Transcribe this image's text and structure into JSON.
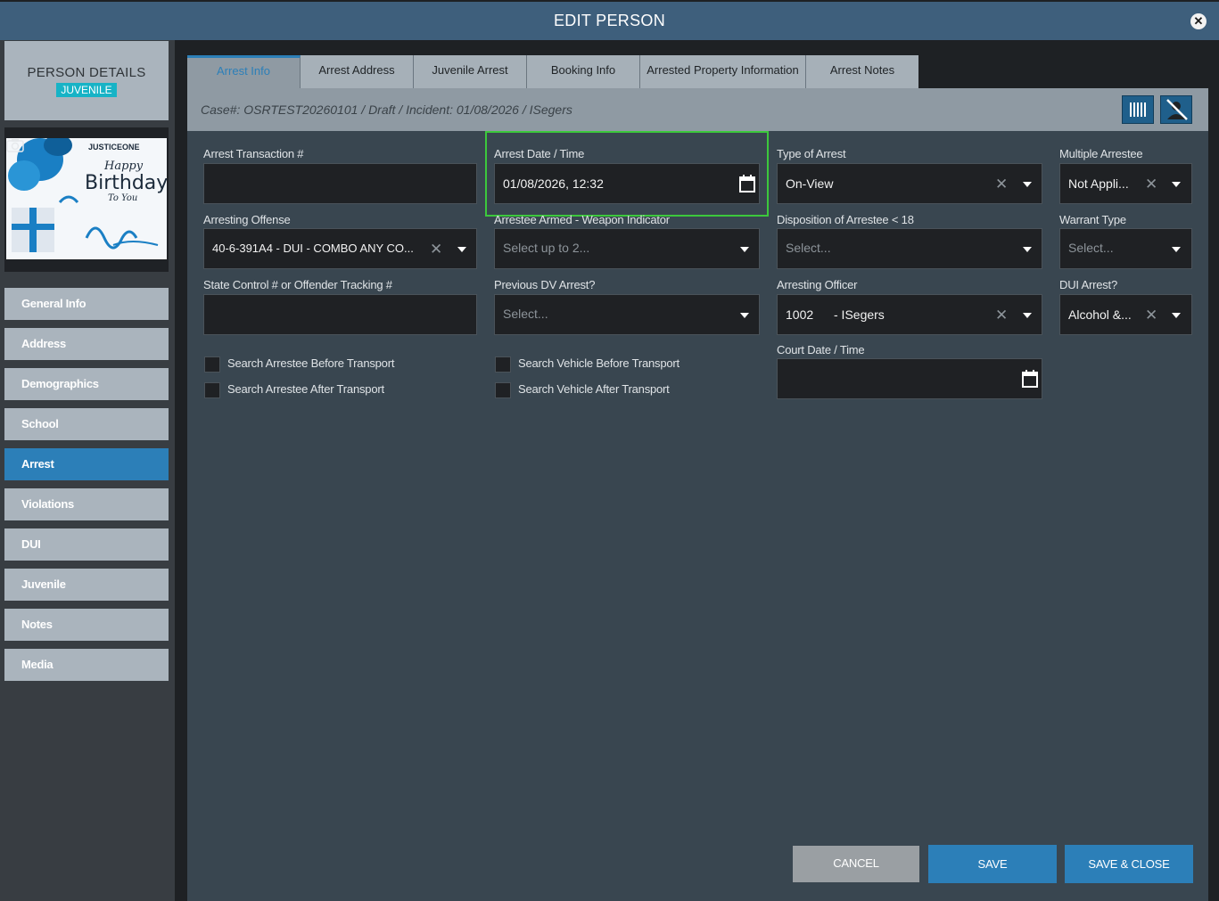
{
  "window": {
    "title": "EDIT PERSON"
  },
  "sidebar": {
    "header": {
      "title": "PERSON DETAILS",
      "badge": "JUVENILE"
    },
    "photo": {
      "line1": "JUSTICEONE",
      "line2": "Happy",
      "line3": "Birthday",
      "line4": "To You"
    },
    "items": [
      {
        "label": "General Info"
      },
      {
        "label": "Address"
      },
      {
        "label": "Demographics"
      },
      {
        "label": "School"
      },
      {
        "label": "Arrest",
        "active": true
      },
      {
        "label": "Violations"
      },
      {
        "label": "DUI"
      },
      {
        "label": "Juvenile"
      },
      {
        "label": "Notes"
      },
      {
        "label": "Media"
      }
    ]
  },
  "tabs": [
    {
      "label": "Arrest Info",
      "active": true
    },
    {
      "label": "Arrest Address"
    },
    {
      "label": "Juvenile Arrest"
    },
    {
      "label": "Booking Info"
    },
    {
      "label": "Arrested Property Information"
    },
    {
      "label": "Arrest Notes"
    }
  ],
  "case_info": "Case#: OSRTEST20260101 / Draft / Incident: 01/08/2026 / ISegers",
  "form": {
    "arrest_transaction": {
      "label": "Arrest Transaction #",
      "value": ""
    },
    "arrest_datetime": {
      "label": "Arrest Date / Time",
      "value": "01/08/2026, 12:32"
    },
    "type_of_arrest": {
      "label": "Type of Arrest",
      "value": "On-View"
    },
    "multiple_arrestee": {
      "label": "Multiple Arrestee",
      "value": "Not Appli..."
    },
    "arresting_offense": {
      "label": "Arresting Offense",
      "value": "40-6-391A4 - DUI - COMBO ANY CO..."
    },
    "armed_weapon": {
      "label": "Arrestee Armed - Weapon Indicator",
      "placeholder": "Select up to 2..."
    },
    "disposition": {
      "label": "Disposition of Arrestee < 18",
      "placeholder": "Select..."
    },
    "warrant_type": {
      "label": "Warrant Type",
      "placeholder": "Select..."
    },
    "state_control": {
      "label": "State Control # or Offender Tracking #",
      "value": ""
    },
    "previous_dv": {
      "label": "Previous DV Arrest?",
      "placeholder": "Select..."
    },
    "arresting_officer": {
      "label": "Arresting Officer",
      "code": "1002",
      "name": "- ISegers"
    },
    "dui_arrest": {
      "label": "DUI Arrest?",
      "value": "Alcohol &..."
    },
    "court_datetime": {
      "label": "Court Date / Time",
      "value": ""
    },
    "checkboxes": [
      {
        "label": "Search Arrestee Before Transport",
        "checked": false
      },
      {
        "label": "Search Arrestee After Transport",
        "checked": false
      },
      {
        "label": "Search Vehicle Before Transport",
        "checked": false
      },
      {
        "label": "Search Vehicle After Transport",
        "checked": false
      }
    ]
  },
  "buttons": {
    "cancel": "CANCEL",
    "save": "SAVE",
    "save_close": "SAVE & CLOSE"
  },
  "colors": {
    "accent": "#2c7fb8",
    "titlebar": "#3e5f7c",
    "badge": "#17b3c6",
    "highlight": "#3cc83c"
  }
}
